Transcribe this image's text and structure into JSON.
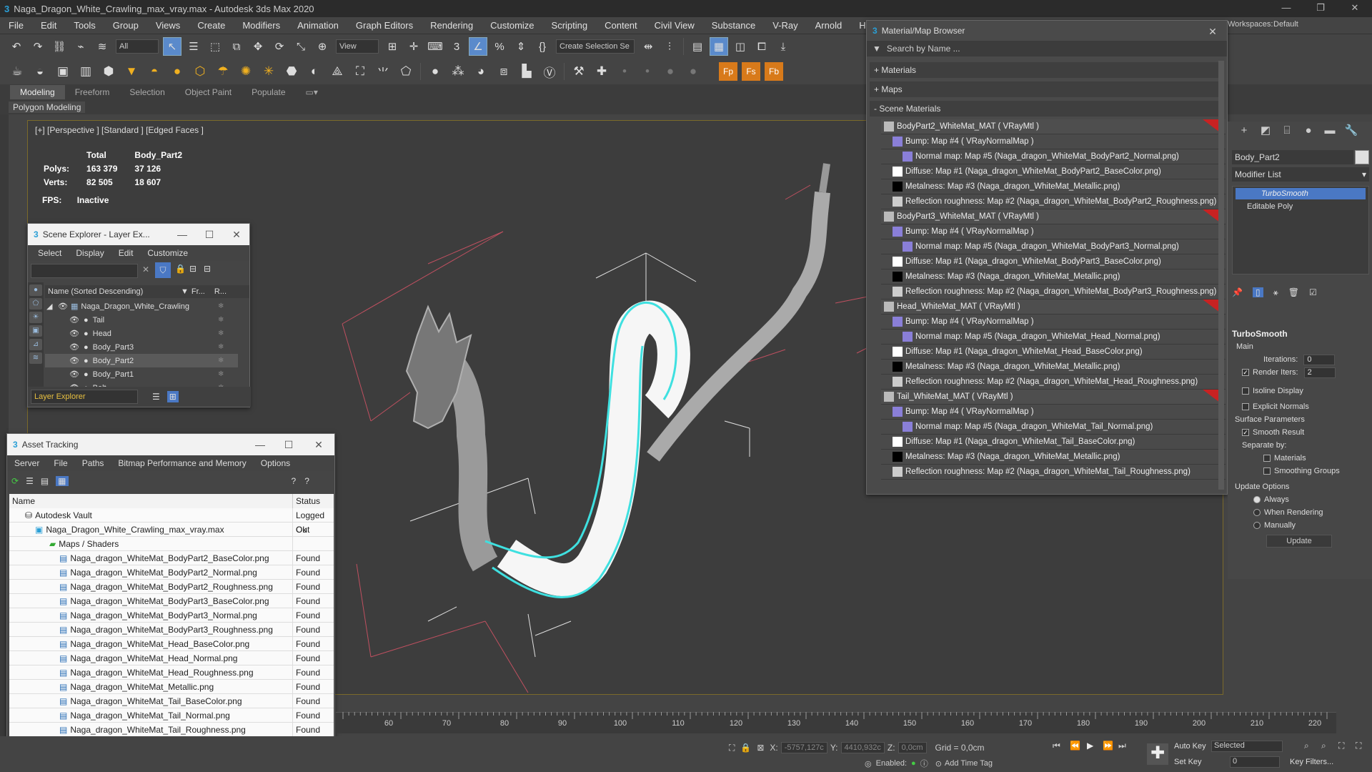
{
  "app": {
    "title": "Naga_Dragon_White_Crawling_max_vray.max - Autodesk 3ds Max 2020",
    "workspaces_label": "Workspaces:",
    "workspace_value": "Default"
  },
  "menu": [
    "File",
    "Edit",
    "Tools",
    "Group",
    "Views",
    "Create",
    "Modifiers",
    "Animation",
    "Graph Editors",
    "Rendering",
    "Customize",
    "Scripting",
    "Content",
    "Civil View",
    "Substance",
    "V-Ray",
    "Arnold",
    "Help"
  ],
  "toolbar": {
    "filter_select": "All",
    "view_select": "View",
    "selection_set": "Create Selection Se"
  },
  "ribbon": {
    "tabs": [
      "Modeling",
      "Freeform",
      "Selection",
      "Object Paint",
      "Populate"
    ],
    "active_tab": "Modeling",
    "panel_label": "Polygon Modeling"
  },
  "viewport": {
    "label": "[+] [Perspective ] [Standard ] [Edged Faces ]",
    "stats_header_total": "Total",
    "stats_header_obj": "Body_Part2",
    "polys_label": "Polys:",
    "polys_total": "163 379",
    "polys_obj": "37 126",
    "verts_label": "Verts:",
    "verts_total": "82 505",
    "verts_obj": "18 607",
    "fps_label": "FPS:",
    "fps_value": "Inactive"
  },
  "scene_explorer": {
    "title": "Scene Explorer - Layer Ex...",
    "menu": [
      "Select",
      "Display",
      "Edit",
      "Customize"
    ],
    "col_name": "Name (Sorted Descending)",
    "col_fr": "Fr...",
    "col_r": "R...",
    "root": "Naga_Dragon_White_Crawling",
    "items": [
      "Tail",
      "Head",
      "Body_Part3",
      "Body_Part2",
      "Body_Part1",
      "Belt"
    ],
    "selected": "Body_Part2",
    "footer_select": "Layer Explorer"
  },
  "asset_tracking": {
    "title": "Asset Tracking",
    "menu": [
      "Server",
      "File",
      "Paths",
      "Bitmap Performance and Memory",
      "Options"
    ],
    "col_name": "Name",
    "col_status": "Status",
    "rows": [
      {
        "name": "Autodesk Vault",
        "status": "Logged Out",
        "indent": 1
      },
      {
        "name": "Naga_Dragon_White_Crawling_max_vray.max",
        "status": "Ok",
        "indent": 2
      },
      {
        "name": "Maps / Shaders",
        "status": "",
        "indent": 3
      },
      {
        "name": "Naga_dragon_WhiteMat_BodyPart2_BaseColor.png",
        "status": "Found",
        "indent": 4
      },
      {
        "name": "Naga_dragon_WhiteMat_BodyPart2_Normal.png",
        "status": "Found",
        "indent": 4
      },
      {
        "name": "Naga_dragon_WhiteMat_BodyPart2_Roughness.png",
        "status": "Found",
        "indent": 4
      },
      {
        "name": "Naga_dragon_WhiteMat_BodyPart3_BaseColor.png",
        "status": "Found",
        "indent": 4
      },
      {
        "name": "Naga_dragon_WhiteMat_BodyPart3_Normal.png",
        "status": "Found",
        "indent": 4
      },
      {
        "name": "Naga_dragon_WhiteMat_BodyPart3_Roughness.png",
        "status": "Found",
        "indent": 4
      },
      {
        "name": "Naga_dragon_WhiteMat_Head_BaseColor.png",
        "status": "Found",
        "indent": 4
      },
      {
        "name": "Naga_dragon_WhiteMat_Head_Normal.png",
        "status": "Found",
        "indent": 4
      },
      {
        "name": "Naga_dragon_WhiteMat_Head_Roughness.png",
        "status": "Found",
        "indent": 4
      },
      {
        "name": "Naga_dragon_WhiteMat_Metallic.png",
        "status": "Found",
        "indent": 4
      },
      {
        "name": "Naga_dragon_WhiteMat_Tail_BaseColor.png",
        "status": "Found",
        "indent": 4
      },
      {
        "name": "Naga_dragon_WhiteMat_Tail_Normal.png",
        "status": "Found",
        "indent": 4
      },
      {
        "name": "Naga_dragon_WhiteMat_Tail_Roughness.png",
        "status": "Found",
        "indent": 4
      }
    ]
  },
  "material_browser": {
    "title": "Material/Map Browser",
    "search_placeholder": "Search by Name ...",
    "sections": [
      "+ Materials",
      "+ Maps",
      "- Scene Materials"
    ],
    "rows": [
      {
        "text": "BodyPart2_WhiteMat_MAT  ( VRayMtl )",
        "level": 0,
        "swatch": "#bbbbbb"
      },
      {
        "text": "Bump: Map #4  ( VRayNormalMap )",
        "level": 1,
        "swatch": "#8a7fd8"
      },
      {
        "text": "Normal map: Map #5 (Naga_dragon_WhiteMat_BodyPart2_Normal.png)",
        "level": 2,
        "swatch": "#8a7fd8"
      },
      {
        "text": "Diffuse: Map #1 (Naga_dragon_WhiteMat_BodyPart2_BaseColor.png)",
        "level": 1,
        "swatch": "#ffffff"
      },
      {
        "text": "Metalness: Map #3 (Naga_dragon_WhiteMat_Metallic.png)",
        "level": 1,
        "swatch": "#000000"
      },
      {
        "text": "Reflection roughness: Map #2 (Naga_dragon_WhiteMat_BodyPart2_Roughness.png)",
        "level": 1,
        "swatch": "#cccccc"
      },
      {
        "text": "BodyPart3_WhiteMat_MAT  ( VRayMtl )",
        "level": 0,
        "swatch": "#bbbbbb"
      },
      {
        "text": "Bump: Map #4  ( VRayNormalMap )",
        "level": 1,
        "swatch": "#8a7fd8"
      },
      {
        "text": "Normal map: Map #5 (Naga_dragon_WhiteMat_BodyPart3_Normal.png)",
        "level": 2,
        "swatch": "#8a7fd8"
      },
      {
        "text": "Diffuse: Map #1 (Naga_dragon_WhiteMat_BodyPart3_BaseColor.png)",
        "level": 1,
        "swatch": "#ffffff"
      },
      {
        "text": "Metalness: Map #3 (Naga_dragon_WhiteMat_Metallic.png)",
        "level": 1,
        "swatch": "#000000"
      },
      {
        "text": "Reflection roughness: Map #2 (Naga_dragon_WhiteMat_BodyPart3_Roughness.png)",
        "level": 1,
        "swatch": "#cccccc"
      },
      {
        "text": "Head_WhiteMat_MAT  ( VRayMtl )",
        "level": 0,
        "swatch": "#bbbbbb"
      },
      {
        "text": "Bump: Map #4  ( VRayNormalMap )",
        "level": 1,
        "swatch": "#8a7fd8"
      },
      {
        "text": "Normal map: Map #5 (Naga_dragon_WhiteMat_Head_Normal.png)",
        "level": 2,
        "swatch": "#8a7fd8"
      },
      {
        "text": "Diffuse: Map #1 (Naga_dragon_WhiteMat_Head_BaseColor.png)",
        "level": 1,
        "swatch": "#ffffff"
      },
      {
        "text": "Metalness: Map #3 (Naga_dragon_WhiteMat_Metallic.png)",
        "level": 1,
        "swatch": "#000000"
      },
      {
        "text": "Reflection roughness: Map #2 (Naga_dragon_WhiteMat_Head_Roughness.png)",
        "level": 1,
        "swatch": "#cccccc"
      },
      {
        "text": "Tail_WhiteMat_MAT  ( VRayMtl )",
        "level": 0,
        "swatch": "#bbbbbb"
      },
      {
        "text": "Bump: Map #4  ( VRayNormalMap )",
        "level": 1,
        "swatch": "#8a7fd8"
      },
      {
        "text": "Normal map: Map #5 (Naga_dragon_WhiteMat_Tail_Normal.png)",
        "level": 2,
        "swatch": "#8a7fd8"
      },
      {
        "text": "Diffuse: Map #1 (Naga_dragon_WhiteMat_Tail_BaseColor.png)",
        "level": 1,
        "swatch": "#ffffff"
      },
      {
        "text": "Metalness: Map #3 (Naga_dragon_WhiteMat_Metallic.png)",
        "level": 1,
        "swatch": "#000000"
      },
      {
        "text": "Reflection roughness: Map #2 (Naga_dragon_WhiteMat_Tail_Roughness.png)",
        "level": 1,
        "swatch": "#cccccc"
      }
    ]
  },
  "command_panel": {
    "object_name": "Body_Part2",
    "modifier_list": "Modifier List",
    "stack": [
      "TurboSmooth",
      "Editable Poly"
    ],
    "rollout_title": "TurboSmooth",
    "main_label": "Main",
    "iterations_label": "Iterations:",
    "iterations_value": "0",
    "render_iters_label": "Render Iters:",
    "render_iters_value": "2",
    "isoline_label": "Isoline Display",
    "explicit_normals_label": "Explicit Normals",
    "surface_params_label": "Surface Parameters",
    "smooth_result_label": "Smooth Result",
    "separate_by_label": "Separate by:",
    "materials_label": "Materials",
    "smoothing_groups_label": "Smoothing Groups",
    "update_options_label": "Update Options",
    "always_label": "Always",
    "when_rendering_label": "When Rendering",
    "manually_label": "Manually",
    "update_button": "Update"
  },
  "timeline": {
    "ticks": [
      "60",
      "70",
      "80",
      "90",
      "100",
      "110",
      "120",
      "130",
      "140",
      "150",
      "160",
      "170",
      "180",
      "190",
      "200",
      "210",
      "220"
    ]
  },
  "status": {
    "x_label": "X:",
    "x_value": "-5757,127c",
    "y_label": "Y:",
    "y_value": "4410,932c",
    "z_label": "Z:",
    "z_value": "0,0cm",
    "grid": "Grid = 0,0cm",
    "enabled_label": "Enabled:",
    "add_time_tag": "Add Time Tag",
    "auto_key": "Auto Key",
    "set_key": "Set Key",
    "selected": "Selected",
    "frame": "0",
    "key_filters": "Key Filters..."
  }
}
